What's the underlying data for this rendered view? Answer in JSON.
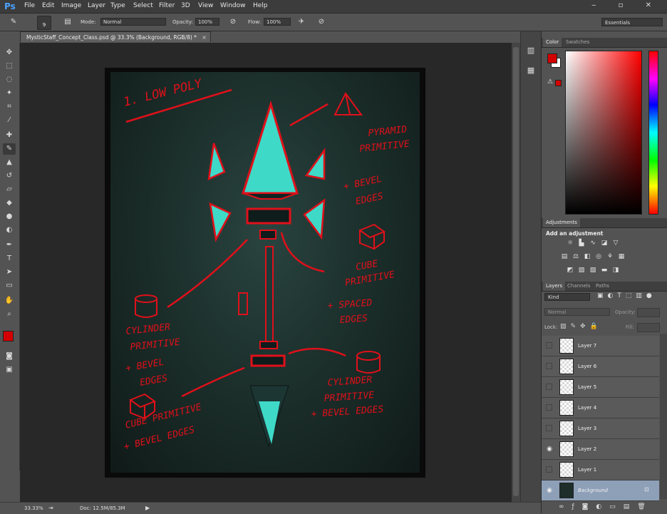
{
  "app": {
    "logo": "Ps"
  },
  "menu": [
    "File",
    "Edit",
    "Image",
    "Layer",
    "Type",
    "Select",
    "Filter",
    "3D",
    "View",
    "Window",
    "Help"
  ],
  "window_controls": "‒ ▫ ✕",
  "options": {
    "brush_size": "9",
    "mode_label": "Mode:",
    "mode_value": "Normal",
    "opacity_label": "Opacity:",
    "opacity_value": "100%",
    "flow_label": "Flow:",
    "flow_value": "100%",
    "workspace": "Essentials"
  },
  "document": {
    "tab_title": "MysticStaff_Concept_Class.psd @ 33.3% (Background, RGB/8) *",
    "close": "×"
  },
  "artwork_annotations": {
    "title": "1. LOW POLY",
    "pyramid_1": "PYRAMID",
    "pyramid_2": "PRIMITIVE",
    "bevel_1a": "+ BEVEL",
    "bevel_1b": "EDGES",
    "cube_1": "CUBE",
    "cube_2": "PRIMITIVE",
    "spaced_1": "+ SPACED",
    "spaced_2": "EDGES",
    "cyl_l1": "CYLINDER",
    "cyl_l2": "PRIMITIVE",
    "cyl_l3": "+ BEVEL",
    "cyl_l4": "EDGES",
    "cyl_r1": "CYLINDER",
    "cyl_r2": "PRIMITIVE",
    "cyl_r3": "+ BEVEL EDGES",
    "cube_b1": "CUBE PRIMITIVE",
    "cube_b2": "+ BEVEL EDGES"
  },
  "status": {
    "zoom": "33.33%",
    "doc": "Doc: 12.5M/85.3M"
  },
  "panels": {
    "color_tabs": [
      "Color",
      "Swatches"
    ],
    "adjustments_tab": "Adjustments",
    "adjustments_title": "Add an adjustment",
    "layers_tabs": [
      "Layers",
      "Channels",
      "Paths"
    ],
    "kind_label": "Kind",
    "blend_mode": "Normal",
    "opacity_label": "Opacity:",
    "lock_label": "Lock:",
    "fill_label": "Fill:"
  },
  "layers": [
    {
      "name": "Layer 7",
      "visible": false
    },
    {
      "name": "Layer 6",
      "visible": false
    },
    {
      "name": "Layer 5",
      "visible": false
    },
    {
      "name": "Layer 4",
      "visible": false
    },
    {
      "name": "Layer 3",
      "visible": false
    },
    {
      "name": "Layer 2",
      "visible": true
    },
    {
      "name": "Layer 1",
      "visible": false
    },
    {
      "name": "Background",
      "visible": true,
      "selected": true,
      "locked": true
    }
  ],
  "colors": {
    "foreground": "#d40000",
    "background": "#ffffff",
    "annotation": "#e0101a",
    "gem": "#3fe0cc"
  }
}
